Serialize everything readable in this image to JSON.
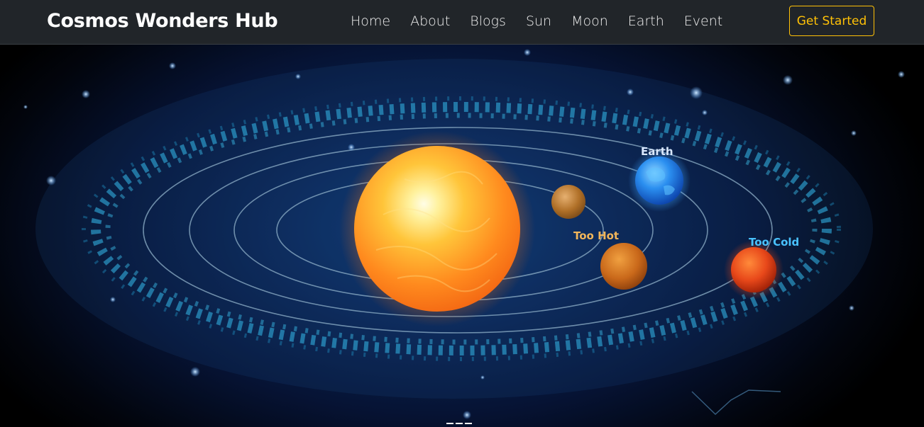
{
  "navbar": {
    "brand": "Cosmos Wonders Hub",
    "links": [
      "Home",
      "About",
      "Blogs",
      "Sun",
      "Moon",
      "Earth",
      "Event"
    ],
    "cta_label": "Get Started",
    "background": "#212529",
    "accent": "#ffc107"
  },
  "hero": {
    "image": "solar-system-illustration",
    "labels": {
      "earth": "Earth",
      "too_hot": "Too Hot",
      "too_cold": "Too Cold"
    },
    "carousel_indicators": 3
  }
}
